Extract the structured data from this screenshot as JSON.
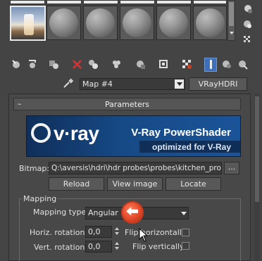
{
  "material_name": "Map #4",
  "map_type_button": "VRayHDRI",
  "rollout": {
    "collapse_symbol": "–",
    "title": "Parameters"
  },
  "banner": {
    "logo_text": "v·ray",
    "title": "V-Ray PowerShader",
    "subtitle": "optimized for V-Ray"
  },
  "bitmap": {
    "label": "Bitmap:",
    "path": "Q:\\aversis\\hdri\\hdr probes\\probes\\kitchen_probe.",
    "browse_label": "..."
  },
  "buttons": {
    "reload": "Reload",
    "view_image": "View image",
    "locate": "Locate"
  },
  "mapping": {
    "group_label": "Mapping",
    "type_label": "Mapping type:",
    "type_value": "Angular",
    "horiz_label": "Horiz. rotation:",
    "horiz_value": "0,0",
    "vert_label": "Vert. rotation:",
    "vert_value": "0,0",
    "flip_h_label": "Flip horizontally",
    "flip_v_label": "Flip vertically"
  },
  "colors": {
    "background": "#444444",
    "accent": "#e24a2a",
    "banner_blue": "#1a4a8a"
  }
}
